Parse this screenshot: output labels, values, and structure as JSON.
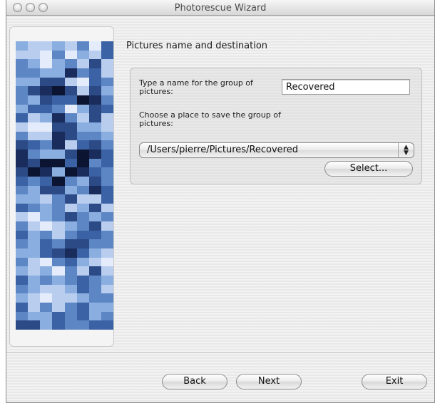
{
  "window": {
    "title": "Photorescue Wizard"
  },
  "titlebar_buttons": [
    {
      "name": "close-button"
    },
    {
      "name": "minimize-button"
    },
    {
      "name": "zoom-button"
    }
  ],
  "page": {
    "heading": "Pictures name and destination",
    "name_label": "Type a name for the group of pictures:",
    "name_value": "Recovered",
    "place_label": "Choose a place to save the group of pictures:",
    "destination_value": "/Users/pierre/Pictures/Recovered",
    "select_button": "Select..."
  },
  "footer": {
    "back": "Back",
    "next": "Next",
    "exit": "Exit"
  },
  "colors": {
    "mosaic_palette": [
      "#0b1431",
      "#1a2c5c",
      "#2b4a86",
      "#3b62a4",
      "#5d86c4",
      "#8aaee0",
      "#b9cdef",
      "#e4ecfb"
    ]
  }
}
